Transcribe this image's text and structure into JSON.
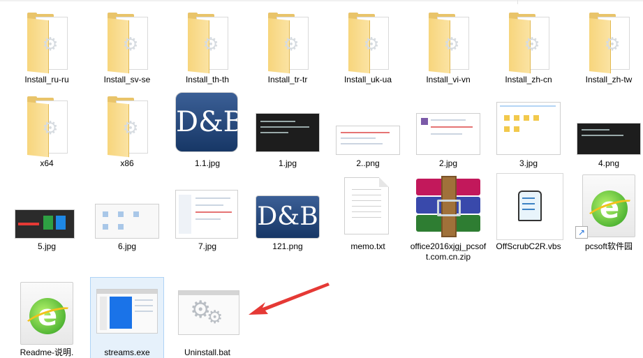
{
  "items": [
    {
      "label": "Install_ru-ru",
      "icon": "folder-icon"
    },
    {
      "label": "Install_sv-se",
      "icon": "folder-icon"
    },
    {
      "label": "Install_th-th",
      "icon": "folder-icon"
    },
    {
      "label": "Install_tr-tr",
      "icon": "folder-icon"
    },
    {
      "label": "Install_uk-ua",
      "icon": "folder-icon"
    },
    {
      "label": "Install_vi-vn",
      "icon": "folder-icon"
    },
    {
      "label": "Install_zh-cn",
      "icon": "folder-icon"
    },
    {
      "label": "Install_zh-tw",
      "icon": "folder-icon"
    },
    {
      "label": "x64",
      "icon": "folder-icon"
    },
    {
      "label": "x86",
      "icon": "folder-icon"
    },
    {
      "label": "1.1.jpg",
      "icon": "db-logo-thumbnail"
    },
    {
      "label": "1.jpg",
      "icon": "terminal-thumbnail"
    },
    {
      "label": "2..png",
      "icon": "screenshot-thumbnail"
    },
    {
      "label": "2.jpg",
      "icon": "context-menu-thumbnail"
    },
    {
      "label": "3.jpg",
      "icon": "explorer-thumbnail"
    },
    {
      "label": "4.png",
      "icon": "terminal-thumbnail"
    },
    {
      "label": "5.jpg",
      "icon": "tiles-thumbnail"
    },
    {
      "label": "6.jpg",
      "icon": "icons-thumbnail"
    },
    {
      "label": "7.jpg",
      "icon": "settings-thumbnail"
    },
    {
      "label": "121.png",
      "icon": "db-logo-thumbnail"
    },
    {
      "label": "memo.txt",
      "icon": "text-document-icon"
    },
    {
      "label": "office2016xjgj_pcsoft.com.cn.zip",
      "icon": "winrar-archive-icon"
    },
    {
      "label": "OffScrubC2R.vbs",
      "icon": "script-file-icon"
    },
    {
      "label": "pcsoft软件园",
      "icon": "ie-shortcut-icon"
    },
    {
      "label": "Readme-说明.",
      "icon": "ie-document-icon"
    },
    {
      "label": "streams.exe",
      "icon": "exe-window-icon"
    },
    {
      "label": "Uninstall.bat",
      "icon": "batch-gear-icon"
    }
  ],
  "db_text": "D&B",
  "colors": {
    "selection_bg": "#e6f1fb",
    "selection_border": "#aed3f6",
    "arrow": "#e53935"
  }
}
